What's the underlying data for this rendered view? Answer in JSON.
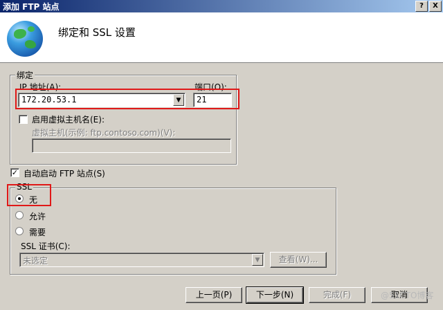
{
  "window": {
    "title": "添加 FTP 站点",
    "help_button": "?",
    "close_button": "X"
  },
  "header": {
    "title": "绑定和 SSL 设置",
    "icon": "globe-icon"
  },
  "binding": {
    "group_label": "绑定",
    "ip_label": "IP 地址(A):",
    "ip_value": "172.20.53.1",
    "port_label": "端口(O):",
    "port_value": "21",
    "virtual_host_checkbox_label": "启用虚拟主机名(E):",
    "virtual_host_checked": false,
    "virtual_host_field_label": "虚拟主机(示例: ftp.contoso.com)(V):",
    "virtual_host_value": ""
  },
  "auto_start": {
    "label": "自动启动 FTP 站点(S)",
    "checked": true
  },
  "ssl": {
    "group_label": "SSL",
    "options": [
      {
        "label": "无",
        "selected": true
      },
      {
        "label": "允许",
        "selected": false
      },
      {
        "label": "需要",
        "selected": false
      }
    ],
    "cert_label": "SSL 证书(C):",
    "cert_value": "未选定",
    "view_button": "查看(W)..."
  },
  "footer": {
    "prev": "上一页(P)",
    "next": "下一步(N)",
    "finish": "完成(F)",
    "cancel": "取消"
  },
  "watermark": "@51CTO博客",
  "colors": {
    "highlight": "#e01818",
    "title_bar": "#0a246a"
  }
}
